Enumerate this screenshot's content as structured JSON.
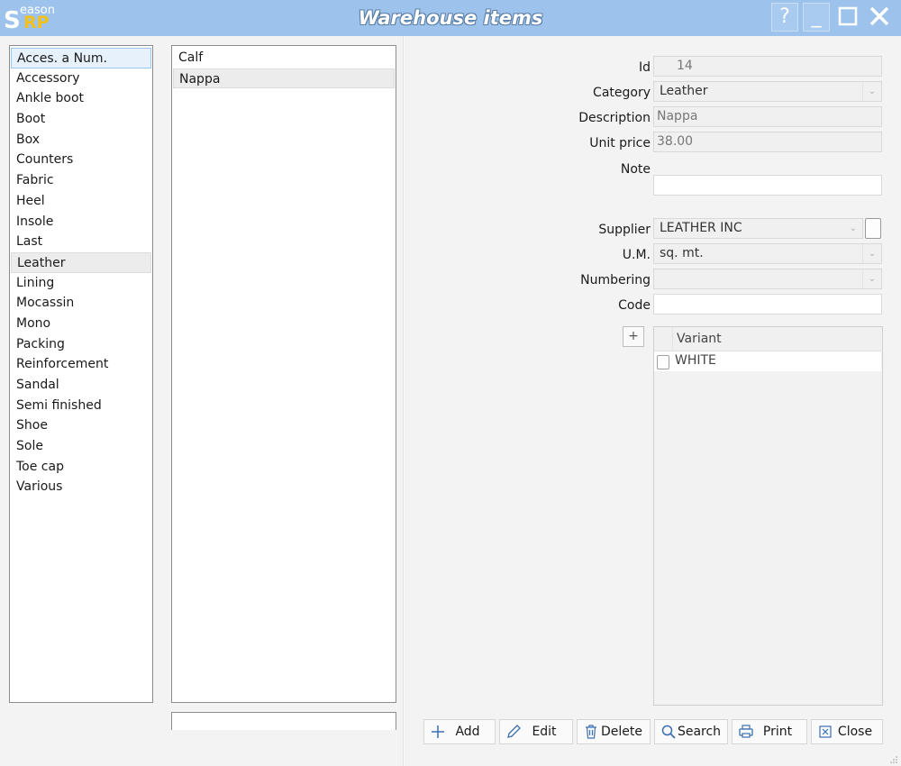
{
  "app": {
    "logo_top": "eason",
    "logo_s": "S",
    "logo_rp": "RP",
    "title": "Warehouse items"
  },
  "window_buttons": {
    "help": "?",
    "minimize": "_",
    "maximize": "☐",
    "close": "✕"
  },
  "categories": [
    "Acces. a Num.",
    "Accessory",
    "Ankle boot",
    "Boot",
    "Box",
    "Counters",
    "Fabric",
    "Heel",
    "Insole",
    "Last",
    "Leather",
    "Lining",
    "Mocassin",
    "Mono",
    "Packing",
    "Reinforcement",
    "Sandal",
    "Semi finished",
    "Shoe",
    "Sole",
    "Toe cap",
    "Various"
  ],
  "selected_category": "Leather",
  "subitems": [
    "Calf",
    "Nappa"
  ],
  "selected_subitem": "Nappa",
  "form": {
    "id_label": "Id",
    "id_value": "14",
    "category_label": "Category",
    "category_value": "Leather",
    "description_label": "Description",
    "description_value": "Nappa",
    "unit_price_label": "Unit price",
    "unit_price_value": "38.00",
    "note_label": "Note",
    "note_value": "",
    "supplier_label": "Supplier",
    "supplier_value": "LEATHER INC",
    "um_label": "U.M.",
    "um_value": "sq. mt.",
    "numbering_label": "Numbering",
    "numbering_value": "",
    "code_label": "Code",
    "code_value": ""
  },
  "variants": {
    "add_label": "+",
    "header": "Variant",
    "rows": [
      "WHITE"
    ]
  },
  "toolbar": {
    "add": "Add",
    "edit": "Edit",
    "delete": "Delete",
    "search": "Search",
    "print": "Print",
    "close": "Close"
  }
}
